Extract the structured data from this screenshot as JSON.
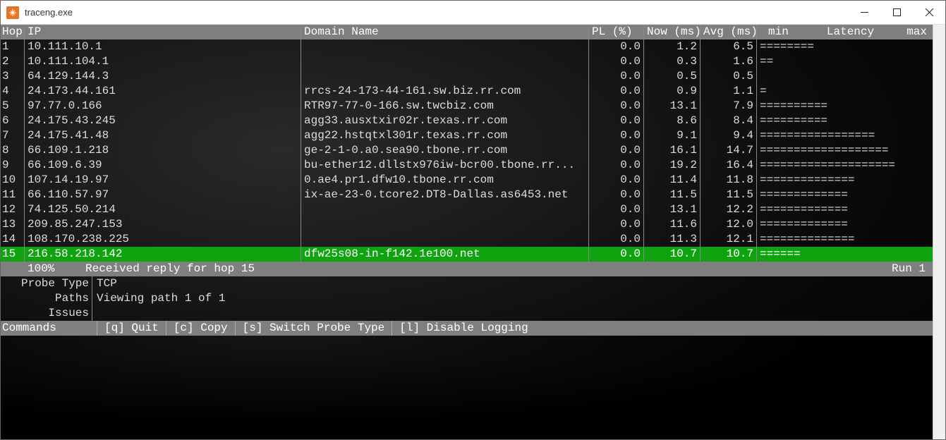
{
  "window": {
    "title": "traceng.exe"
  },
  "columns": {
    "hop": "Hop",
    "ip": "IP",
    "domain": "Domain Name",
    "pl": "PL (%)",
    "now": "Now (ms)",
    "avg": "Avg (ms)",
    "lat_min": "min",
    "lat_mid": "Latency",
    "lat_max": "max"
  },
  "hops": [
    {
      "n": "1",
      "ip": "10.111.10.1",
      "domain": "",
      "pl": "0.0",
      "now": "1.2",
      "avg": "6.5",
      "bar": "========",
      "sel": false
    },
    {
      "n": "2",
      "ip": "10.111.104.1",
      "domain": "",
      "pl": "0.0",
      "now": "0.3",
      "avg": "1.6",
      "bar": "==",
      "sel": false
    },
    {
      "n": "3",
      "ip": "64.129.144.3",
      "domain": "",
      "pl": "0.0",
      "now": "0.5",
      "avg": "0.5",
      "bar": "",
      "sel": false
    },
    {
      "n": "4",
      "ip": "24.173.44.161",
      "domain": "rrcs-24-173-44-161.sw.biz.rr.com",
      "pl": "0.0",
      "now": "0.9",
      "avg": "1.1",
      "bar": "=",
      "sel": false
    },
    {
      "n": "5",
      "ip": "97.77.0.166",
      "domain": "RTR97-77-0-166.sw.twcbiz.com",
      "pl": "0.0",
      "now": "13.1",
      "avg": "7.9",
      "bar": "==========",
      "sel": false
    },
    {
      "n": "6",
      "ip": "24.175.43.245",
      "domain": "agg33.ausxtxir02r.texas.rr.com",
      "pl": "0.0",
      "now": "8.6",
      "avg": "8.4",
      "bar": "==========",
      "sel": false
    },
    {
      "n": "7",
      "ip": "24.175.41.48",
      "domain": "agg22.hstqtxl301r.texas.rr.com",
      "pl": "0.0",
      "now": "9.1",
      "avg": "9.4",
      "bar": "=================",
      "sel": false
    },
    {
      "n": "8",
      "ip": "66.109.1.218",
      "domain": "ge-2-1-0.a0.sea90.tbone.rr.com",
      "pl": "0.0",
      "now": "16.1",
      "avg": "14.7",
      "bar": "===================",
      "sel": false
    },
    {
      "n": "9",
      "ip": "66.109.6.39",
      "domain": "bu-ether12.dllstx976iw-bcr00.tbone.rr...",
      "pl": "0.0",
      "now": "19.2",
      "avg": "16.4",
      "bar": "====================",
      "sel": false
    },
    {
      "n": "10",
      "ip": "107.14.19.97",
      "domain": "0.ae4.pr1.dfw10.tbone.rr.com",
      "pl": "0.0",
      "now": "11.4",
      "avg": "11.8",
      "bar": "==============",
      "sel": false
    },
    {
      "n": "11",
      "ip": "66.110.57.97",
      "domain": "ix-ae-23-0.tcore2.DT8-Dallas.as6453.net",
      "pl": "0.0",
      "now": "11.5",
      "avg": "11.5",
      "bar": "=============",
      "sel": false
    },
    {
      "n": "12",
      "ip": "74.125.50.214",
      "domain": "",
      "pl": "0.0",
      "now": "13.1",
      "avg": "12.2",
      "bar": "=============",
      "sel": false
    },
    {
      "n": "13",
      "ip": "209.85.247.153",
      "domain": "",
      "pl": "0.0",
      "now": "11.6",
      "avg": "12.0",
      "bar": "=============",
      "sel": false
    },
    {
      "n": "14",
      "ip": "108.170.238.225",
      "domain": "",
      "pl": "0.0",
      "now": "11.3",
      "avg": "12.1",
      "bar": "==============",
      "sel": false
    },
    {
      "n": "15",
      "ip": "216.58.218.142",
      "domain": "dfw25s08-in-f142.1e100.net",
      "pl": "0.0",
      "now": "10.7",
      "avg": "10.7",
      "bar": "======",
      "sel": true
    }
  ],
  "status": {
    "percent": "100%",
    "message": "Received reply for hop 15",
    "run": "Run 1"
  },
  "footer": {
    "probe_label": "Probe Type",
    "probe_value": "TCP",
    "paths_label": "Paths",
    "paths_value": "Viewing path 1 of 1",
    "issues_label": "Issues",
    "issues_value": ""
  },
  "commands": {
    "label": "Commands",
    "items": [
      {
        "text": "[q] Quit"
      },
      {
        "text": "[c] Copy"
      },
      {
        "text": "[s] Switch Probe Type"
      },
      {
        "text": "[l] Disable Logging"
      }
    ]
  }
}
